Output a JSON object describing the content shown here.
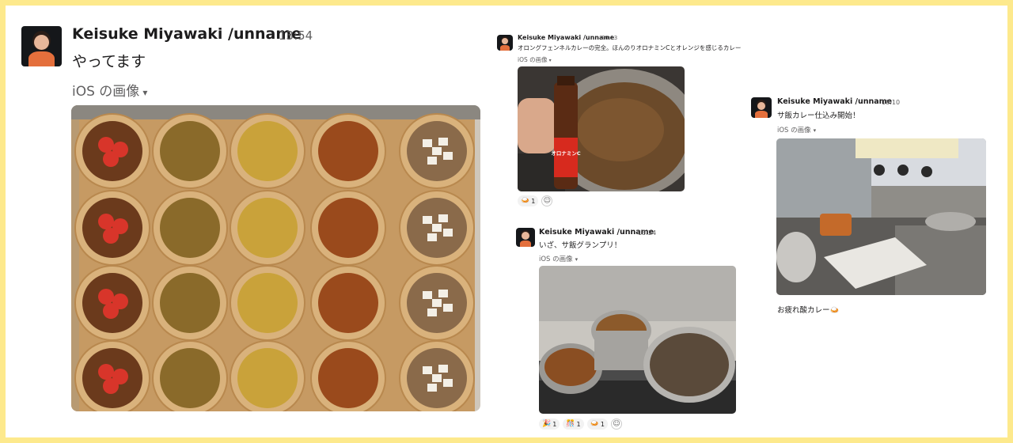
{
  "messages": [
    {
      "author": "Keisuke Miyawaki /unname",
      "time": "13:54",
      "text": "やってます",
      "file_label": "iOS の画像"
    },
    {
      "author": "Keisuke Miyawaki /unname",
      "time": "20:23",
      "text": "オロングフェンネルカレーの完全。ほんのりオロナミンCとオレンジを感じるカレー",
      "file_label": "iOS の画像",
      "bottle_label": "オロナミンC",
      "reactions": [
        {
          "emoji": "🍛",
          "count": "1"
        }
      ]
    },
    {
      "author": "Keisuke Miyawaki /unname",
      "time": "13:24",
      "text": "いざ、サ飯グランプリ！",
      "file_label": "iOS の画像",
      "reactions": [
        {
          "emoji": "🎉",
          "count": "1"
        },
        {
          "emoji": "🎊",
          "count": "1"
        },
        {
          "emoji": "🍛",
          "count": "1"
        }
      ]
    },
    {
      "author": "Keisuke Miyawaki /unname",
      "time": "18:10",
      "text": "サ飯カレー仕込み開始！",
      "file_label": "iOS の画像",
      "caption": "お疲れ酸カレー🍛"
    }
  ],
  "icons": {
    "caret": "▾",
    "add_reaction": "☺"
  },
  "colors": {
    "frame": "#fde98c",
    "muted": "#616061"
  }
}
